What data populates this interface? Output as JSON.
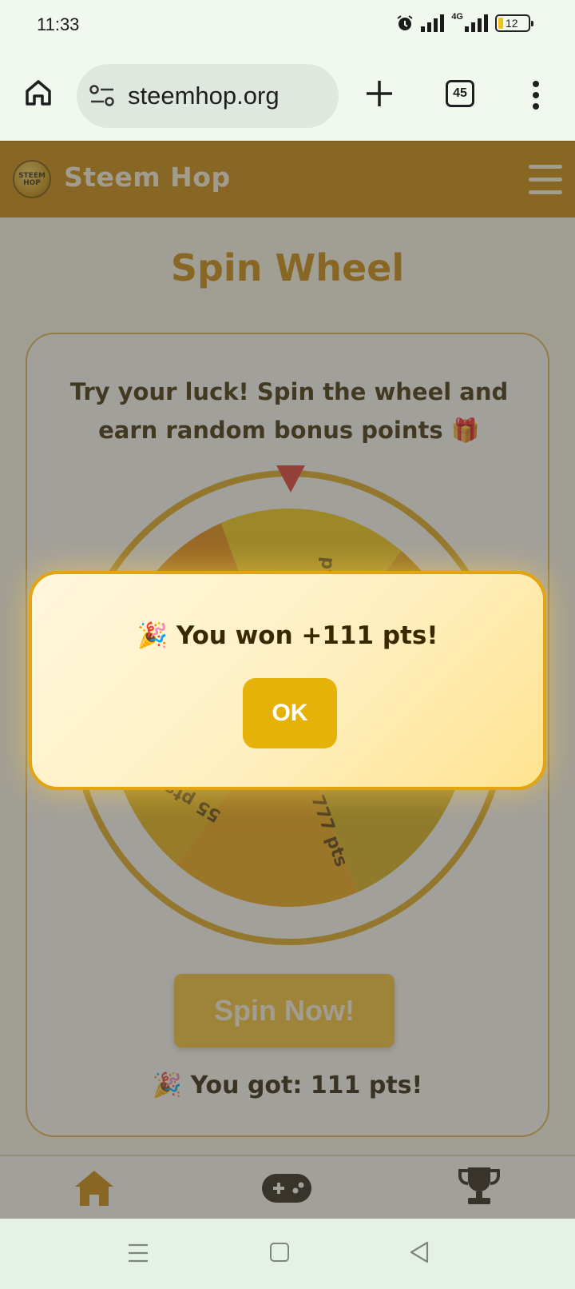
{
  "status_bar": {
    "time": "11:33",
    "network": "4G",
    "battery": "12"
  },
  "browser": {
    "url": "steemhop.org",
    "tab_count": "45"
  },
  "site": {
    "title": "Steem Hop",
    "logo_text": "STEEM HOP"
  },
  "page": {
    "title": "Spin Wheel",
    "tagline": "Try your luck! Spin the wheel and earn random bonus points 🎁",
    "spin_button": "Spin Now!",
    "result": "🎉 You got: 111 pts!"
  },
  "wheel": {
    "visible_labels": [
      "pts",
      "777 pts",
      "55 pts"
    ],
    "colors": [
      "#f2c80c",
      "#e89a08",
      "#d8b010",
      "#f0a40a",
      "#e8b40c",
      "#ea8c06"
    ]
  },
  "modal": {
    "message": "🎉 You won +111 pts!",
    "ok_label": "OK"
  },
  "bottom_nav": {
    "items": [
      "home-icon",
      "gamepad-icon",
      "trophy-icon"
    ],
    "active_color": "#c98900"
  },
  "colors": {
    "brand": "#c98900",
    "accent": "#e6b20a"
  }
}
